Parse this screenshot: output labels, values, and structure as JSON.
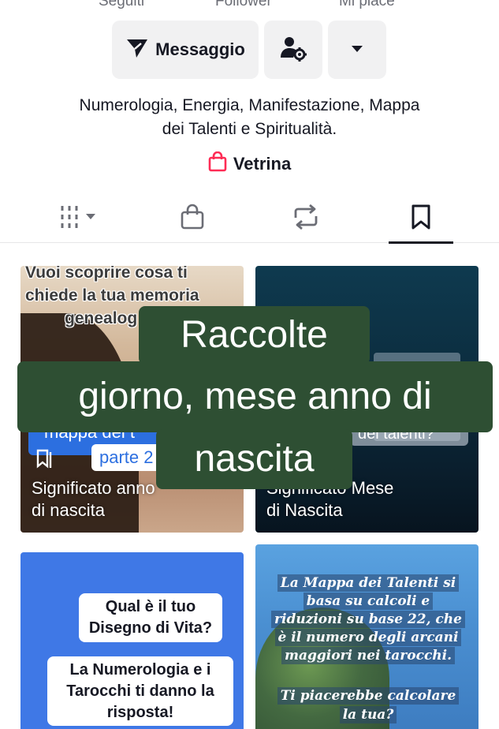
{
  "stats": {
    "following_label": "Seguiti",
    "followers_label": "Follower",
    "likes_label": "Mi piace"
  },
  "actions": {
    "message_label": "Messaggio",
    "message_icon": "send-icon",
    "add_friend_icon": "user-settings-icon",
    "more_icon": "caret-down-icon"
  },
  "bio": {
    "line1": "Numerologia, Energia, Manifestazione, Mappa",
    "line2": "dei Talenti e Spiritualità."
  },
  "shop": {
    "label": "Vetrina",
    "icon": "shopping-bag-icon",
    "accent_color": "#fe2c55"
  },
  "tabs": [
    {
      "icon": "videos-grid-icon",
      "active": false
    },
    {
      "icon": "shop-bag-icon",
      "active": false
    },
    {
      "icon": "repost-icon",
      "active": false
    },
    {
      "icon": "bookmark-icon",
      "active": true
    }
  ],
  "grid": [
    {
      "top_text": [
        "Vuoi scoprire cosa ti",
        "chiede la tua memoria",
        "genealog"
      ],
      "band_text": "mappa dei t",
      "part_label": "parte 2",
      "caption": [
        "Significato anno",
        "di nascita"
      ]
    },
    {
      "band_text": "dei talenti?",
      "caption": [
        "Significato Mese",
        "di Nascita"
      ]
    },
    {
      "box1": [
        "Qual è il tuo",
        "Disegno di Vita?"
      ],
      "box2": [
        "La Numerologia e i",
        "Tarocchi ti danno la",
        "risposta!"
      ]
    },
    {
      "text": [
        "La Mappa dei Talenti si",
        "basa su calcoli e",
        "riduzioni su base 22, che",
        "è il numero degli arcani",
        "maggiori nei tarocchi."
      ],
      "question": [
        "Ti piacerebbe calcolare",
        "la tua?"
      ]
    }
  ],
  "overlay": {
    "line1": "Raccolte",
    "line2": "giorno, mese anno di",
    "line3": "nascita",
    "background": "#2e4f33"
  }
}
